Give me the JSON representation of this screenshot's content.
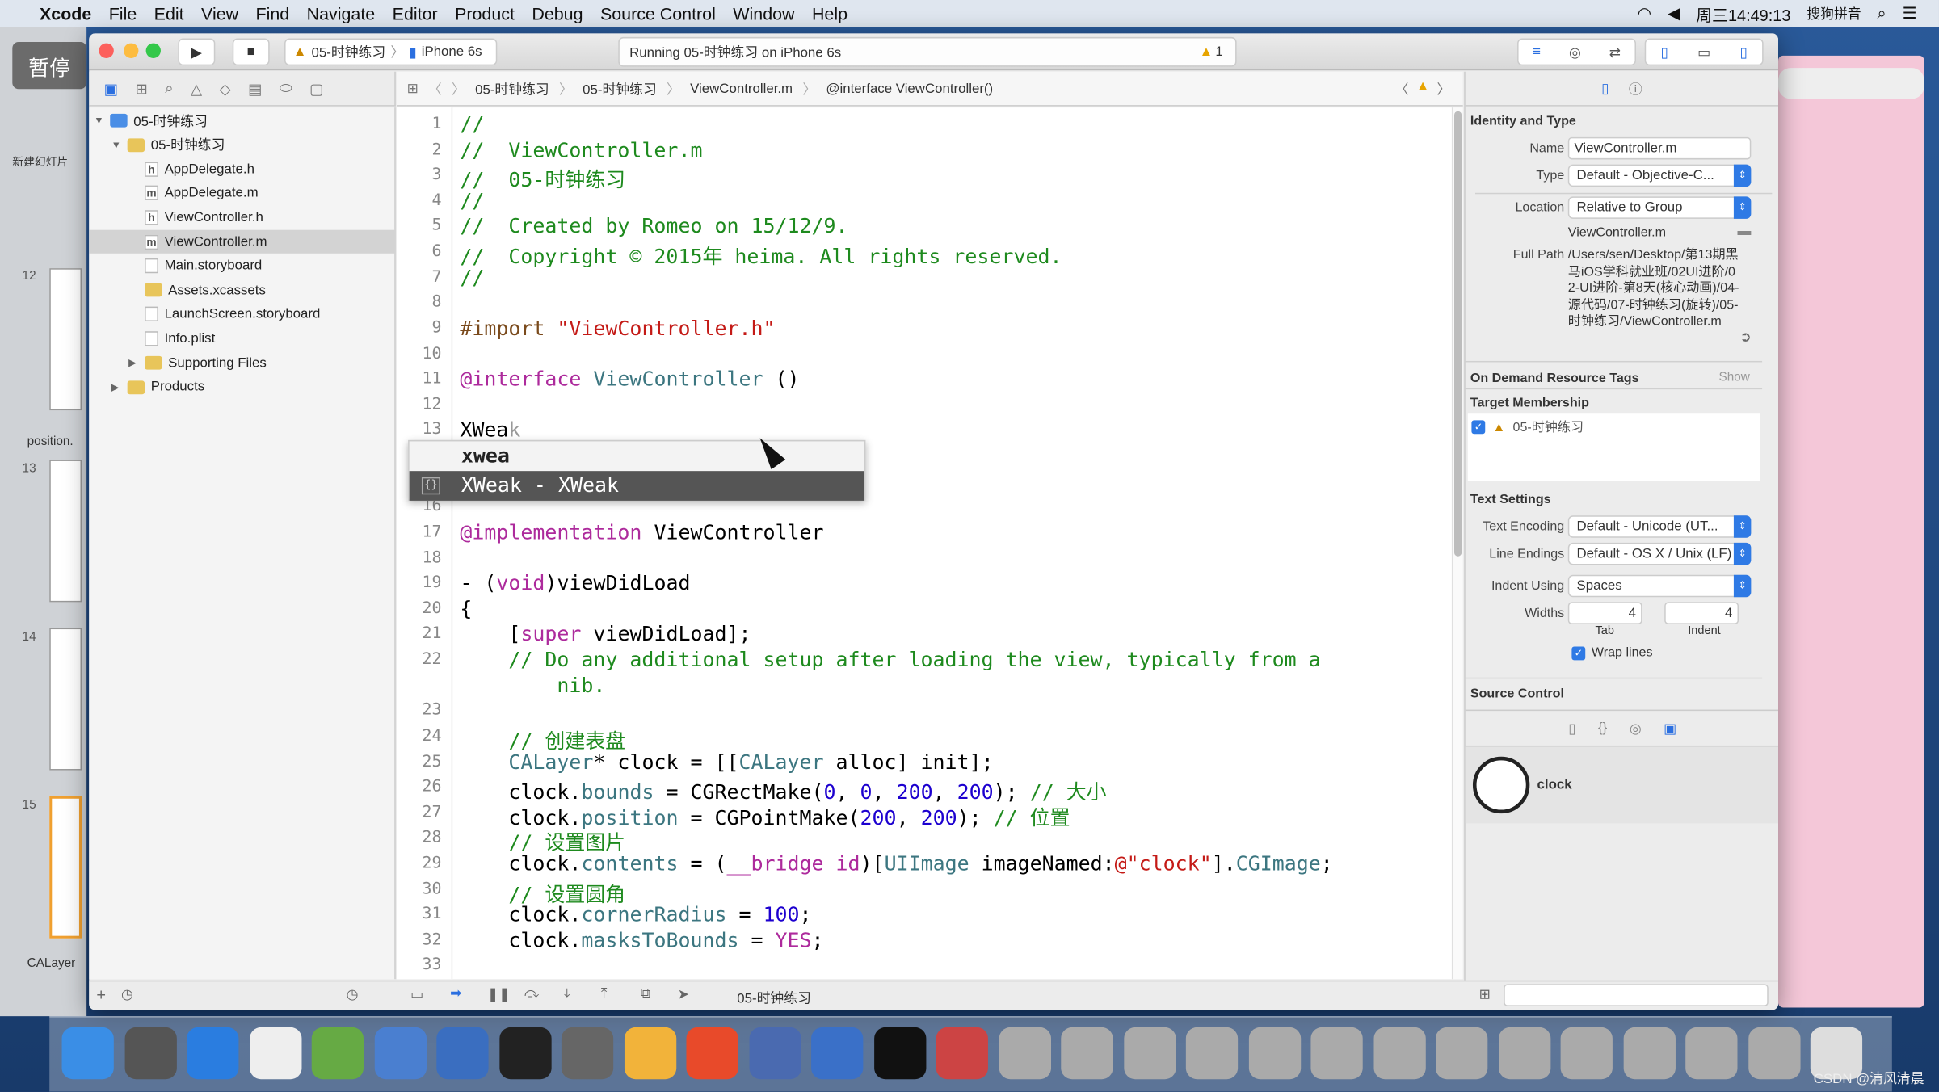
{
  "menubar": {
    "app": "Xcode",
    "items": [
      "File",
      "Edit",
      "View",
      "Find",
      "Navigate",
      "Editor",
      "Product",
      "Debug",
      "Source Control",
      "Window",
      "Help"
    ],
    "clock": "周三14:49:13",
    "input_method": "搜狗拼音"
  },
  "overlay": {
    "pause_label": "暂停"
  },
  "keynote": {
    "slide_numbers": [
      "12",
      "13",
      "14",
      "15"
    ],
    "new_slide": "新建幻灯片",
    "sections": [
      "position.",
      "CALayer"
    ]
  },
  "toolbar": {
    "scheme": "05-时钟练习",
    "device": "iPhone 6s",
    "activity": "Running 05-时钟练习 on iPhone 6s",
    "warning_count": "1"
  },
  "navigator": {
    "items": [
      {
        "label": "05-时钟练习",
        "kind": "project",
        "level": 0,
        "open": true
      },
      {
        "label": "05-时钟练习",
        "kind": "folder",
        "level": 1,
        "open": true
      },
      {
        "label": "AppDelegate.h",
        "kind": "h",
        "level": 2
      },
      {
        "label": "AppDelegate.m",
        "kind": "m",
        "level": 2
      },
      {
        "label": "ViewController.h",
        "kind": "h",
        "level": 2
      },
      {
        "label": "ViewController.m",
        "kind": "m",
        "level": 2,
        "selected": true
      },
      {
        "label": "Main.storyboard",
        "kind": "file",
        "level": 2
      },
      {
        "label": "Assets.xcassets",
        "kind": "folder",
        "level": 2
      },
      {
        "label": "LaunchScreen.storyboard",
        "kind": "file",
        "level": 2
      },
      {
        "label": "Info.plist",
        "kind": "file",
        "level": 2
      },
      {
        "label": "Supporting Files",
        "kind": "folder",
        "level": 2,
        "open": false
      },
      {
        "label": "Products",
        "kind": "folder",
        "level": 1,
        "open": false
      }
    ]
  },
  "jumpbar": {
    "crumbs": [
      "05-时钟练习",
      "05-时钟练习",
      "ViewController.m",
      "@interface ViewController()"
    ]
  },
  "editor": {
    "lines": [
      {
        "n": "1",
        "s": [
          [
            "//",
            "comment"
          ]
        ]
      },
      {
        "n": "2",
        "s": [
          [
            "//  ViewController.m",
            "comment"
          ]
        ]
      },
      {
        "n": "3",
        "s": [
          [
            "//  05-时钟练习",
            "comment"
          ]
        ]
      },
      {
        "n": "4",
        "s": [
          [
            "//",
            "comment"
          ]
        ]
      },
      {
        "n": "5",
        "s": [
          [
            "//  Created by Romeo on 15/12/9.",
            "comment"
          ]
        ]
      },
      {
        "n": "6",
        "s": [
          [
            "//  Copyright © 2015年 heima. All rights reserved.",
            "comment"
          ]
        ]
      },
      {
        "n": "7",
        "s": [
          [
            "//",
            "comment"
          ]
        ]
      },
      {
        "n": "8",
        "s": []
      },
      {
        "n": "9",
        "s": [
          [
            "#import ",
            "pre"
          ],
          [
            "\"ViewController.h\"",
            "str"
          ]
        ]
      },
      {
        "n": "10",
        "s": []
      },
      {
        "n": "11",
        "s": [
          [
            "@interface ",
            "kw"
          ],
          [
            "ViewController",
            "cls"
          ],
          [
            " ()",
            "typed"
          ]
        ]
      },
      {
        "n": "12",
        "s": []
      },
      {
        "n": "13",
        "s": [
          [
            "XWea",
            "typed"
          ],
          [
            "k",
            "ghost"
          ]
        ]
      },
      {
        "n": "14",
        "s": []
      },
      {
        "n": "15",
        "s": []
      },
      {
        "n": "16",
        "s": []
      },
      {
        "n": "17",
        "s": [
          [
            "@implementation ",
            "kw"
          ],
          [
            "ViewController",
            "typed"
          ]
        ]
      },
      {
        "n": "18",
        "s": []
      },
      {
        "n": "19",
        "s": [
          [
            "- (",
            "typed"
          ],
          [
            "void",
            "kw"
          ],
          [
            ")viewDidLoad",
            "typed"
          ]
        ]
      },
      {
        "n": "20",
        "s": [
          [
            "{",
            "typed"
          ]
        ]
      },
      {
        "n": "21",
        "s": [
          [
            "    [",
            "typed"
          ],
          [
            "super",
            "kw"
          ],
          [
            " viewDidLoad];",
            "typed"
          ]
        ]
      },
      {
        "n": "22",
        "s": [
          [
            "    // Do any additional setup after loading the view, typically from a",
            "comment"
          ]
        ]
      },
      {
        "n": "",
        "s": [
          [
            "        nib.",
            "comment"
          ]
        ]
      },
      {
        "n": "23",
        "s": []
      },
      {
        "n": "24",
        "s": [
          [
            "    // 创建表盘",
            "comment"
          ]
        ]
      },
      {
        "n": "25",
        "s": [
          [
            "    CALayer",
            "cls"
          ],
          [
            "* clock = [[",
            "typed"
          ],
          [
            "CALayer",
            "cls"
          ],
          [
            " alloc] init];",
            "typed"
          ]
        ]
      },
      {
        "n": "26",
        "s": [
          [
            "    clock.",
            "typed"
          ],
          [
            "bounds",
            "prop"
          ],
          [
            " = CGRectMake(",
            "typed"
          ],
          [
            "0",
            "num"
          ],
          [
            ", ",
            "typed"
          ],
          [
            "0",
            "num"
          ],
          [
            ", ",
            "typed"
          ],
          [
            "200",
            "num"
          ],
          [
            ", ",
            "typed"
          ],
          [
            "200",
            "num"
          ],
          [
            "); ",
            "typed"
          ],
          [
            "// 大小",
            "comment"
          ]
        ]
      },
      {
        "n": "27",
        "s": [
          [
            "    clock.",
            "typed"
          ],
          [
            "position",
            "prop"
          ],
          [
            " = CGPointMake(",
            "typed"
          ],
          [
            "200",
            "num"
          ],
          [
            ", ",
            "typed"
          ],
          [
            "200",
            "num"
          ],
          [
            "); ",
            "typed"
          ],
          [
            "// 位置",
            "comment"
          ]
        ]
      },
      {
        "n": "28",
        "s": [
          [
            "    // 设置图片",
            "comment"
          ]
        ]
      },
      {
        "n": "29",
        "s": [
          [
            "    clock.",
            "typed"
          ],
          [
            "contents",
            "prop"
          ],
          [
            " = (",
            "typed"
          ],
          [
            "__bridge",
            "kw"
          ],
          [
            " ",
            "typed"
          ],
          [
            "id",
            "kw"
          ],
          [
            ")[",
            "typed"
          ],
          [
            "UIImage",
            "cls"
          ],
          [
            " imageNamed:",
            "typed"
          ],
          [
            "@\"clock\"",
            "str"
          ],
          [
            "].",
            "typed"
          ],
          [
            "CGImage",
            "prop"
          ],
          [
            ";",
            "typed"
          ]
        ]
      },
      {
        "n": "30",
        "s": [
          [
            "    // 设置圆角",
            "comment"
          ]
        ]
      },
      {
        "n": "31",
        "s": [
          [
            "    clock.",
            "typed"
          ],
          [
            "cornerRadius",
            "prop"
          ],
          [
            " = ",
            "typed"
          ],
          [
            "100",
            "num"
          ],
          [
            ";",
            "typed"
          ]
        ]
      },
      {
        "n": "32",
        "s": [
          [
            "    clock.",
            "typed"
          ],
          [
            "masksToBounds",
            "prop"
          ],
          [
            " = ",
            "typed"
          ],
          [
            "YES",
            "kw"
          ],
          [
            ";",
            "typed"
          ]
        ]
      },
      {
        "n": "33",
        "s": []
      }
    ]
  },
  "autocomplete": {
    "items": [
      "xwea",
      "XWeak - XWeak"
    ],
    "selected_index": 1,
    "icon": "{}"
  },
  "inspector": {
    "identity_title": "Identity and Type",
    "name_label": "Name",
    "name_value": "ViewController.m",
    "type_label": "Type",
    "type_value": "Default - Objective-C...",
    "location_label": "Location",
    "location_value": "Relative to Group",
    "location_file": "ViewController.m",
    "fullpath_label": "Full Path",
    "fullpath_value": "/Users/sen/Desktop/第13期黑马iOS学科就业班/02UI进阶/02-UI进阶-第8天(核心动画)/04-源代码/07-时钟练习(旋转)/05-时钟练习/ViewController.m",
    "odr_title": "On Demand Resource Tags",
    "odr_show": "Show",
    "target_title": "Target Membership",
    "target_item": "05-时钟练习",
    "target_checked": true,
    "text_title": "Text Settings",
    "encoding_label": "Text Encoding",
    "encoding_value": "Default - Unicode (UT...",
    "endings_label": "Line Endings",
    "endings_value": "Default - OS X / Unix (LF)",
    "indent_label": "Indent Using",
    "indent_value": "Spaces",
    "widths_label": "Widths",
    "tab_value": "4",
    "indent_width_value": "4",
    "tab_label": "Tab",
    "indent_sub_label": "Indent",
    "wrap_label": "Wrap lines",
    "wrap_checked": true,
    "sc_title": "Source Control",
    "library_item": "clock"
  },
  "debugbar": {
    "target": "05-时钟练习"
  },
  "watermark": "CSDN @清风清晨",
  "colors": {
    "comment": "#1e8a1e",
    "keyword": "#ad2a9c",
    "string": "#c41a16",
    "class": "#3c7680",
    "number": "#1c00cf",
    "accent": "#2f7ae5"
  }
}
